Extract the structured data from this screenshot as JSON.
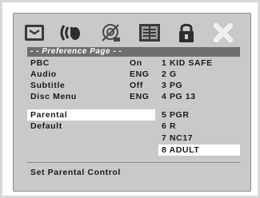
{
  "menu": {
    "header": "- - Preference Page - -",
    "icons": [
      "general-setup-icon",
      "audio-setup-icon",
      "video-setup-icon",
      "preference-icon",
      "password-lock-icon",
      "exit-icon"
    ],
    "items": [
      {
        "label": "PBC",
        "value": "On"
      },
      {
        "label": "Audio",
        "value": "ENG"
      },
      {
        "label": "Subtitle",
        "value": "Off"
      },
      {
        "label": "Disc Menu",
        "value": "ENG"
      },
      {
        "label": "Parental",
        "value": ""
      },
      {
        "label": "Default",
        "value": ""
      }
    ],
    "selected_item": "Parental",
    "parental_options": [
      "1 KID SAFE",
      "2 G",
      "3 PG",
      "4 PG 13",
      "5 PGR",
      "6 R",
      "7 NC17",
      "8 ADULT"
    ],
    "selected_option": "8 ADULT",
    "status": "Set Parental Control"
  }
}
